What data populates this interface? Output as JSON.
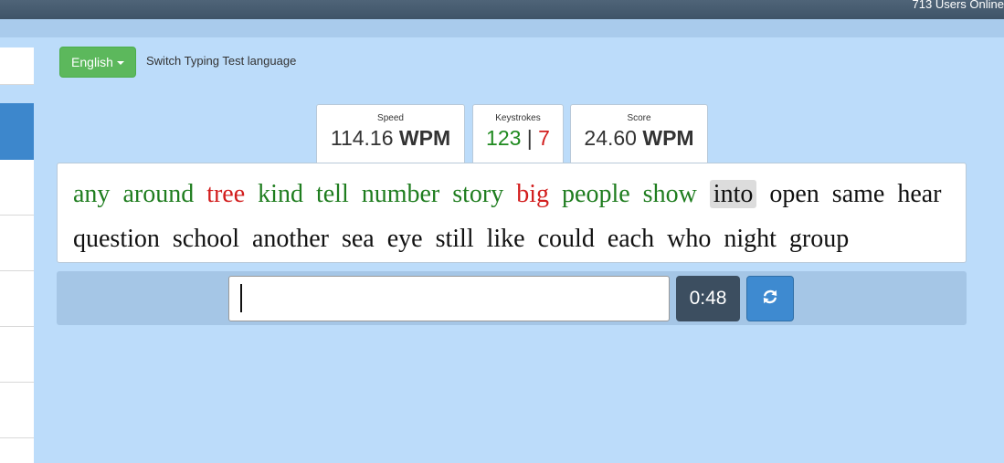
{
  "header": {
    "users_online": "713 Users Online"
  },
  "language": {
    "button_label": "English",
    "description": "Switch Typing Test language"
  },
  "stats": {
    "speed": {
      "label": "Speed",
      "value": "114.16",
      "unit": "WPM"
    },
    "keystrokes": {
      "label": "Keystrokes",
      "correct": "123",
      "separator": "|",
      "wrong": "7"
    },
    "score": {
      "label": "Score",
      "value": "24.60",
      "unit": "WPM"
    }
  },
  "words": [
    {
      "text": "any",
      "state": "correct"
    },
    {
      "text": "around",
      "state": "correct"
    },
    {
      "text": "tree",
      "state": "wrong"
    },
    {
      "text": "kind",
      "state": "correct"
    },
    {
      "text": "tell",
      "state": "correct"
    },
    {
      "text": "number",
      "state": "correct"
    },
    {
      "text": "story",
      "state": "correct"
    },
    {
      "text": "big",
      "state": "wrong"
    },
    {
      "text": "people",
      "state": "correct"
    },
    {
      "text": "show",
      "state": "correct"
    },
    {
      "text": "into",
      "state": "current"
    },
    {
      "text": "open",
      "state": "pending"
    },
    {
      "text": "same",
      "state": "pending"
    },
    {
      "text": "hear",
      "state": "pending"
    },
    {
      "text": "question",
      "state": "pending"
    },
    {
      "text": "school",
      "state": "pending"
    },
    {
      "text": "another",
      "state": "pending"
    },
    {
      "text": "sea",
      "state": "pending"
    },
    {
      "text": "eye",
      "state": "pending"
    },
    {
      "text": "still",
      "state": "pending"
    },
    {
      "text": "like",
      "state": "pending"
    },
    {
      "text": "could",
      "state": "pending"
    },
    {
      "text": "each",
      "state": "pending"
    },
    {
      "text": "who",
      "state": "pending"
    },
    {
      "text": "night",
      "state": "pending"
    },
    {
      "text": "group",
      "state": "pending"
    }
  ],
  "input": {
    "value": "",
    "placeholder": ""
  },
  "timer": {
    "value": "0:48"
  },
  "icons": {
    "reload": "refresh-icon",
    "caret": "caret-down-icon"
  },
  "colors": {
    "correct": "#1f7d1f",
    "wrong": "#d21d1d",
    "language_button": "#5cb85c",
    "reload_button": "#3e8ad0",
    "timer": "#3c4e60",
    "background": "#bcdcfa"
  }
}
